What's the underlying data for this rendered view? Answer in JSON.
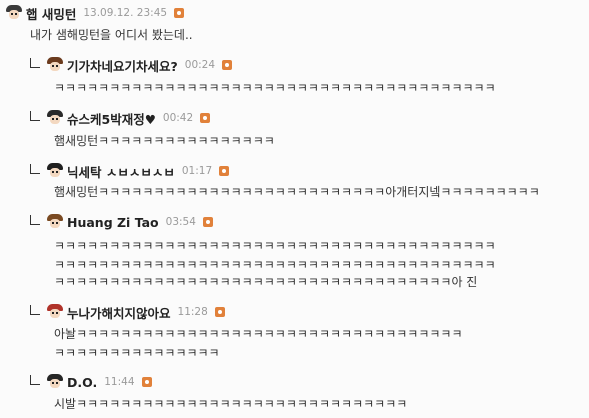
{
  "post": {
    "author": "햅 새밍턴",
    "time": "13.09.12. 23:45",
    "text": "내가 샘해밍턴을 어디서 봤는데.."
  },
  "replies": [
    {
      "author": "기가차네요기차세요?",
      "time": "00:24",
      "lines": [
        "ㅋㅋㅋㅋㅋㅋㅋㅋㅋㅋㅋㅋㅋㅋㅋㅋㅋㅋㅋㅋㅋㅋㅋㅋㅋㅋㅋㅋㅋㅋㅋㅋㅋㅋㅋㅋㅋㅋㅋㅋ"
      ]
    },
    {
      "author": "슈스케5박재정♥",
      "time": "00:42",
      "lines": [
        "햄새밍턴ㅋㅋㅋㅋㅋㅋㅋㅋㅋㅋㅋㅋㅋㅋㅋㅋ"
      ]
    },
    {
      "author": "닉세탁 ㅅㅂㅅㅂㅅㅂ",
      "time": "01:17",
      "lines": [
        "햄새밍턴ㅋㅋㅋㅋㅋㅋㅋㅋㅋㅋㅋㅋㅋㅋㅋㅋㅋㅋㅋㅋㅋㅋㅋㅋㅋㅋ아개터지넼ㅋㅋㅋㅋㅋㅋㅋㅋㅋ"
      ]
    },
    {
      "author": "Huang Zi Tao",
      "time": "03:54",
      "lines": [
        "ㅋㅋㅋㅋㅋㅋㅋㅋㅋㅋㅋㅋㅋㅋㅋㅋㅋㅋㅋㅋㅋㅋㅋㅋㅋㅋㅋㅋㅋㅋㅋㅋㅋㅋㅋㅋㅋㅋㅋㅋ",
        "ㅋㅋㅋㅋㅋㅋㅋㅋㅋㅋㅋㅋㅋㅋㅋㅋㅋㅋㅋㅋㅋㅋㅋㅋㅋㅋㅋㅋㅋㅋㅋㅋㅋㅋㅋㅋㅋㅋㅋㅋ",
        "ㅋㅋㅋㅋㅋㅋㅋㅋㅋㅋㅋㅋㅋㅋㅋㅋㅋㅋㅋㅋㅋㅋㅋㅋㅋㅋㅋㅋㅋㅋㅋㅋㅋㅋㅋㅋ아 진"
      ]
    },
    {
      "author": "누나가해치지않아요",
      "time": "11:28",
      "lines": [
        "아놜ㅋㅋㅋㅋㅋㅋㅋㅋㅋㅋㅋㅋㅋㅋㅋㅋㅋㅋㅋㅋㅋㅋㅋㅋㅋㅋㅋㅋㅋㅋㅋㅋㅋㅋㅋ",
        "ㅋㅋㅋㅋㅋㅋㅋㅋㅋㅋㅋㅋㅋㅋㅋ"
      ]
    },
    {
      "author": "D.O.",
      "time": "11:44",
      "lines": [
        "시발ㅋㅋㅋㅋㅋㅋㅋㅋㅋㅋㅋㅋㅋㅋㅋㅋㅋㅋㅋㅋㅋㅋㅋㅋㅋㅋㅋㅋㅋㅋ"
      ]
    }
  ],
  "colors": {
    "background": "#fbfbfb",
    "rss_orange": "#e1813a",
    "time_gray": "#9a9a9a",
    "text": "#333333"
  },
  "icons": {
    "avatar": "user-avatar-icon",
    "rss": "rss-feed-icon",
    "reply": "reply-arrow-icon"
  }
}
